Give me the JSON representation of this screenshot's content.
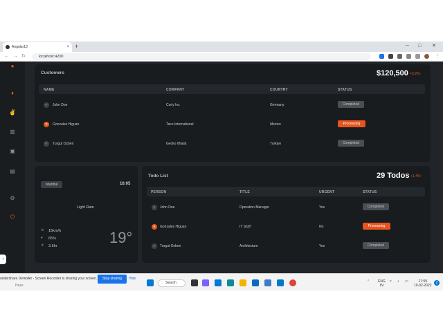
{
  "browser": {
    "tab_title": "Angular13",
    "tab_close": "×",
    "new_tab": "+",
    "url": "localhost:4200",
    "win_min": "─",
    "win_max": "□",
    "win_close": "✕"
  },
  "sidebar": {
    "items": [
      {
        "icon": "user-icon",
        "glyph": "●"
      },
      {
        "icon": "drop-icon",
        "glyph": "♦"
      },
      {
        "icon": "hand-icon",
        "glyph": "✌"
      },
      {
        "icon": "archive-icon",
        "glyph": "▥"
      },
      {
        "icon": "document-icon",
        "glyph": "▣"
      },
      {
        "icon": "briefcase-icon",
        "glyph": "▤"
      },
      {
        "icon": "gear-icon",
        "glyph": "⚙"
      },
      {
        "icon": "power-icon",
        "glyph": "⏻"
      }
    ],
    "toggle": "›"
  },
  "customers": {
    "title": "Customers",
    "total": "$120,500",
    "delta": "+3.2%↑",
    "headers": [
      "NAME",
      "COMPANY",
      "COUNTRY",
      "STATUS"
    ],
    "rows": [
      {
        "name": "John Doe",
        "company": "Curly Inc",
        "country": "Germany",
        "status": "Completed",
        "state": "ok"
      },
      {
        "name": "Gonzales Higuan",
        "company": "Taco International",
        "country": "Mexico",
        "status": "Processing",
        "state": "err"
      },
      {
        "name": "Turgut Ozben",
        "company": "Gecko Ithalat",
        "country": "Turkiye",
        "status": "Completed",
        "state": "ok"
      }
    ]
  },
  "weather": {
    "city": "Istanbul",
    "time": "16:05",
    "condition": "Light Rain",
    "wind": "15km/h",
    "humidity": "65%",
    "hours": "3.5hr",
    "temp": "19°"
  },
  "todos": {
    "title": "Todo List",
    "count": "29 Todos",
    "delta": "+1.4%↑",
    "headers": [
      "PERSON",
      "TITLE",
      "URGENT",
      "STATUS"
    ],
    "rows": [
      {
        "person": "John Doe",
        "title": "Operation Manager",
        "urgent": "Yes",
        "status": "Completed",
        "state": "ok"
      },
      {
        "person": "Gonzales Higuan",
        "title": "IT Stuff",
        "urgent": "No",
        "status": "Processing",
        "state": "err"
      },
      {
        "person": "Turgut Ozben",
        "title": "Architecture",
        "urgent": "Yes",
        "status": "Completed",
        "state": "ok"
      }
    ]
  },
  "sharebar": {
    "text": "ondershare DemoAir - Screen Recorder is sharing your screen.",
    "stop": "Stop sharing",
    "hide": "Hide",
    "sub": "Haze"
  },
  "taskbar": {
    "search": "Search",
    "lang1": "ENG",
    "lang2": "IN",
    "time": "17:59",
    "date": "10-02-2022",
    "notif": "2"
  },
  "colors": {
    "accent": "#e8541e",
    "background": "#212529",
    "card": "#191c1f"
  }
}
